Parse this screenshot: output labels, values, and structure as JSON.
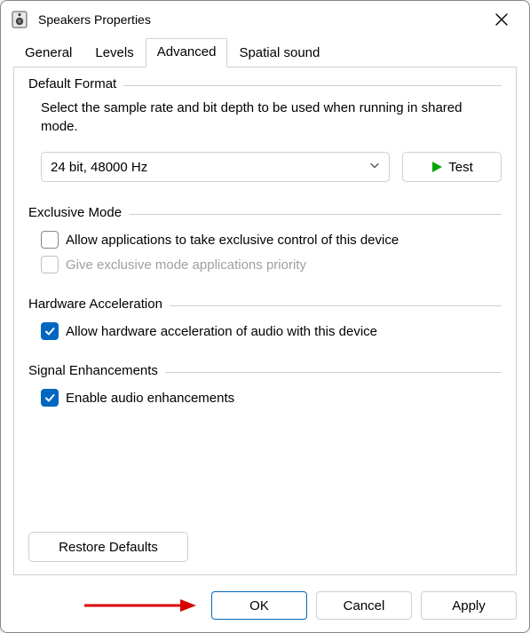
{
  "window": {
    "title": "Speakers Properties"
  },
  "tabs": {
    "general": "General",
    "levels": "Levels",
    "advanced": "Advanced",
    "spatial": "Spatial sound",
    "active": "advanced"
  },
  "default_format": {
    "legend": "Default Format",
    "description": "Select the sample rate and bit depth to be used when running in shared mode.",
    "selected": "24 bit, 48000 Hz",
    "test_label": "Test"
  },
  "exclusive_mode": {
    "legend": "Exclusive Mode",
    "allow_exclusive_label": "Allow applications to take exclusive control of this device",
    "allow_exclusive_checked": false,
    "priority_label": "Give exclusive mode applications priority",
    "priority_checked": false,
    "priority_disabled": true
  },
  "hardware_acceleration": {
    "legend": "Hardware Acceleration",
    "allow_label": "Allow hardware acceleration of audio with this device",
    "allow_checked": true
  },
  "signal_enhancements": {
    "legend": "Signal Enhancements",
    "enable_label": "Enable audio enhancements",
    "enable_checked": true
  },
  "restore_defaults_label": "Restore Defaults",
  "buttons": {
    "ok": "OK",
    "cancel": "Cancel",
    "apply": "Apply"
  }
}
